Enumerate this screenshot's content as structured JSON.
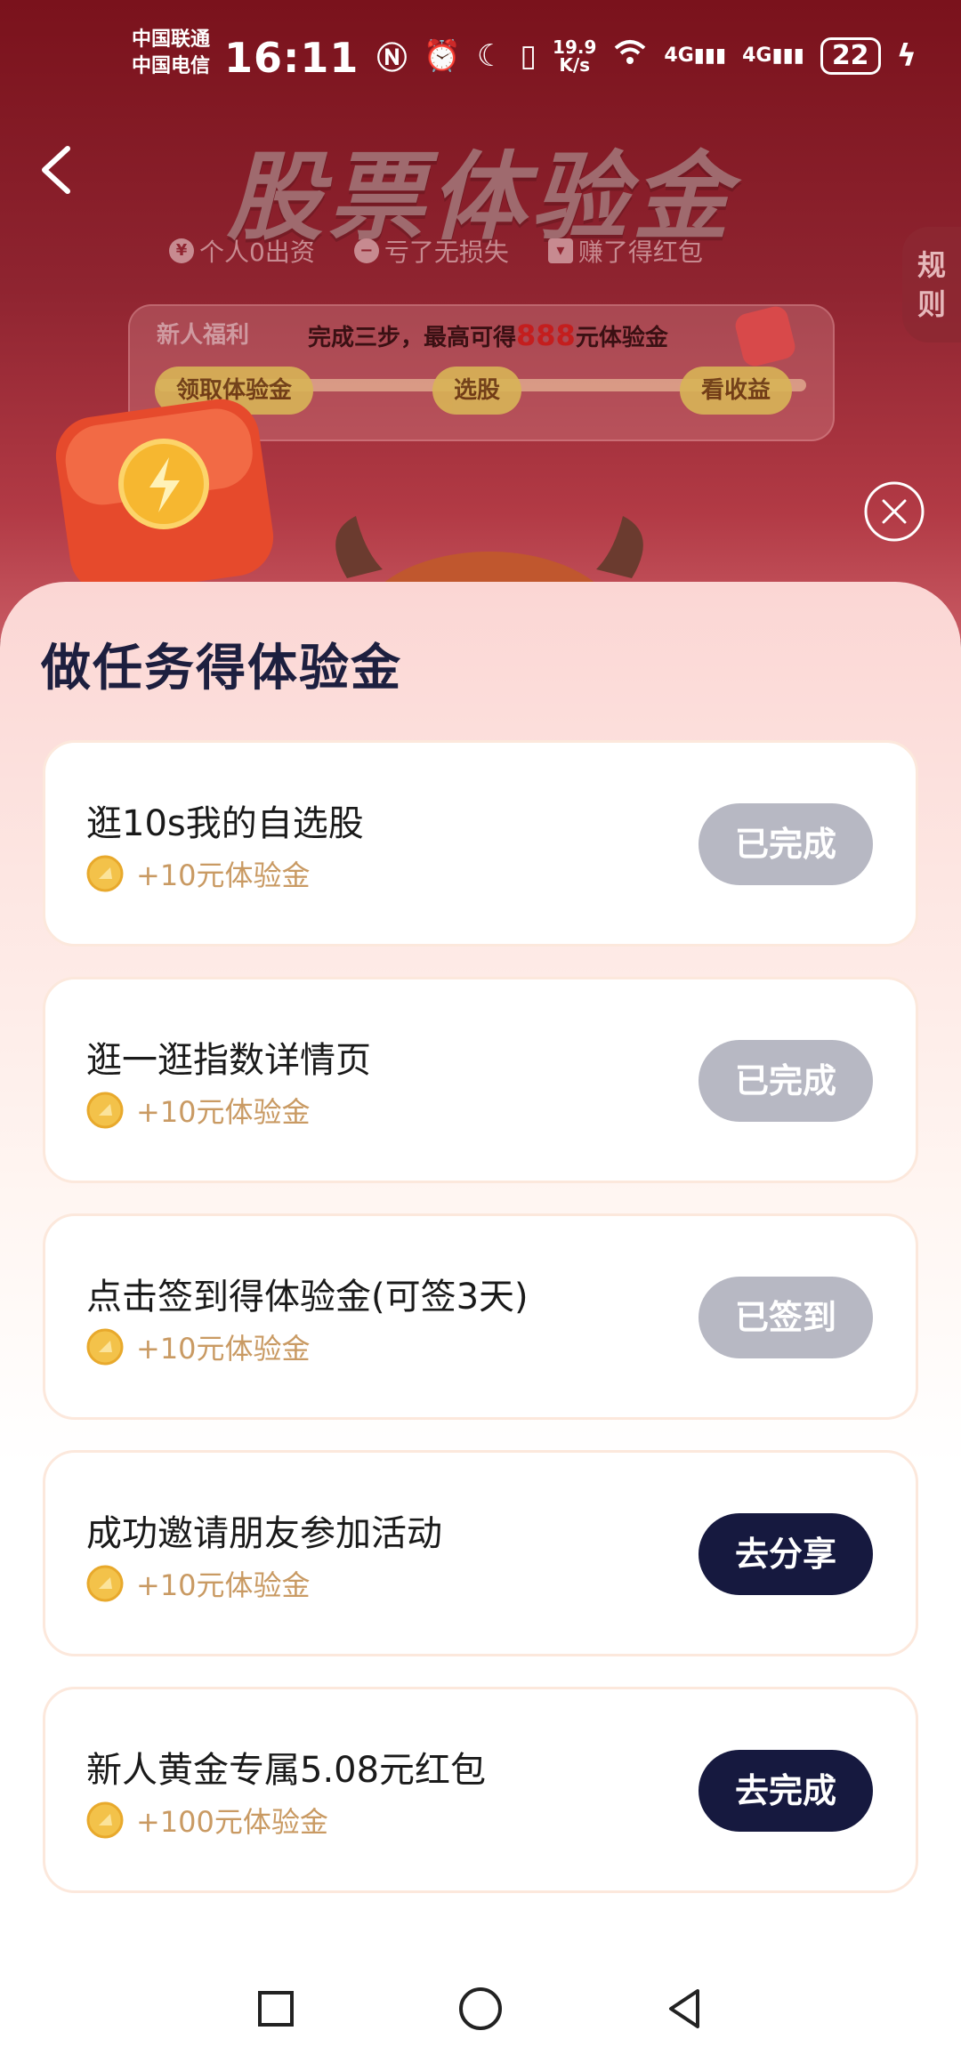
{
  "status_bar": {
    "carrier1": "中国联通",
    "carrier2": "中国电信",
    "time": "16:11",
    "net_speed_value": "19.9",
    "net_speed_unit": "K/s",
    "signal1": "4G",
    "signal2": "4G",
    "battery": "22"
  },
  "header": {
    "title": "股票体验金",
    "tags": [
      "个人0出资",
      "亏了无损失",
      "赚了得红包"
    ],
    "rules_label_1": "规",
    "rules_label_2": "则",
    "welfare": {
      "label": "新人福利",
      "desc_prefix": "完成三步，最高可得",
      "desc_amount": "888",
      "desc_suffix": "元体验金",
      "steps": [
        "领取体验金",
        "选股",
        "看收益"
      ]
    }
  },
  "sheet": {
    "title": "做任务得体验金",
    "tasks": [
      {
        "title": "逛10s我的自选股",
        "reward": "+10元体验金",
        "button": "已完成",
        "state": "done"
      },
      {
        "title": "逛一逛指数详情页",
        "reward": "+10元体验金",
        "button": "已完成",
        "state": "done"
      },
      {
        "title": "点击签到得体验金(可签3天)",
        "reward": "+10元体验金",
        "button": "已签到",
        "state": "done"
      },
      {
        "title": "成功邀请朋友参加活动",
        "reward": "+10元体验金",
        "button": "去分享",
        "state": "go"
      },
      {
        "title": "新人黄金专属5.08元红包",
        "reward": "+100元体验金",
        "button": "去完成",
        "state": "go"
      }
    ]
  },
  "colors": {
    "done_button": "#b7b8c3",
    "go_button": "#16193f",
    "reward_text": "#c99a63"
  },
  "icons": [
    "back-icon",
    "close-icon",
    "coin-icon",
    "nav-square-icon",
    "nav-circle-icon",
    "nav-back-icon"
  ]
}
